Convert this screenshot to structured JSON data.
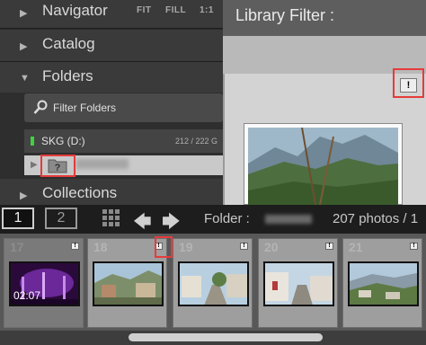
{
  "left_panel": {
    "navigator": {
      "title": "Navigator",
      "options": [
        "FIT",
        "FILL",
        "1:1"
      ]
    },
    "catalog": {
      "title": "Catalog"
    },
    "folders": {
      "title": "Folders",
      "filter_label": "Filter Folders",
      "volume": {
        "name": "SKG (D:)",
        "size": "212 / 222 G",
        "status_color": "#3fd13f"
      },
      "selected_folder_icon": "missing-folder-icon"
    },
    "collections": {
      "title": "Collections"
    }
  },
  "library_filter": {
    "title": "Library Filter :",
    "badge": "!"
  },
  "toolbar": {
    "page1": "1",
    "page2": "2",
    "folder_label": "Folder :",
    "photo_count": "207 photos / 1"
  },
  "filmstrip": {
    "cells": [
      {
        "number": "17",
        "badge": "!",
        "selected": true,
        "timecode": "02:07"
      },
      {
        "number": "18",
        "badge": "!",
        "selected": false
      },
      {
        "number": "19",
        "badge": "!",
        "selected": false
      },
      {
        "number": "20",
        "badge": "!",
        "selected": false
      },
      {
        "number": "21",
        "badge": "!",
        "selected": false
      }
    ]
  },
  "colors": {
    "highlight": "#e63b3b",
    "panel": "#2a2a2a",
    "filmstrip": "#585858"
  }
}
